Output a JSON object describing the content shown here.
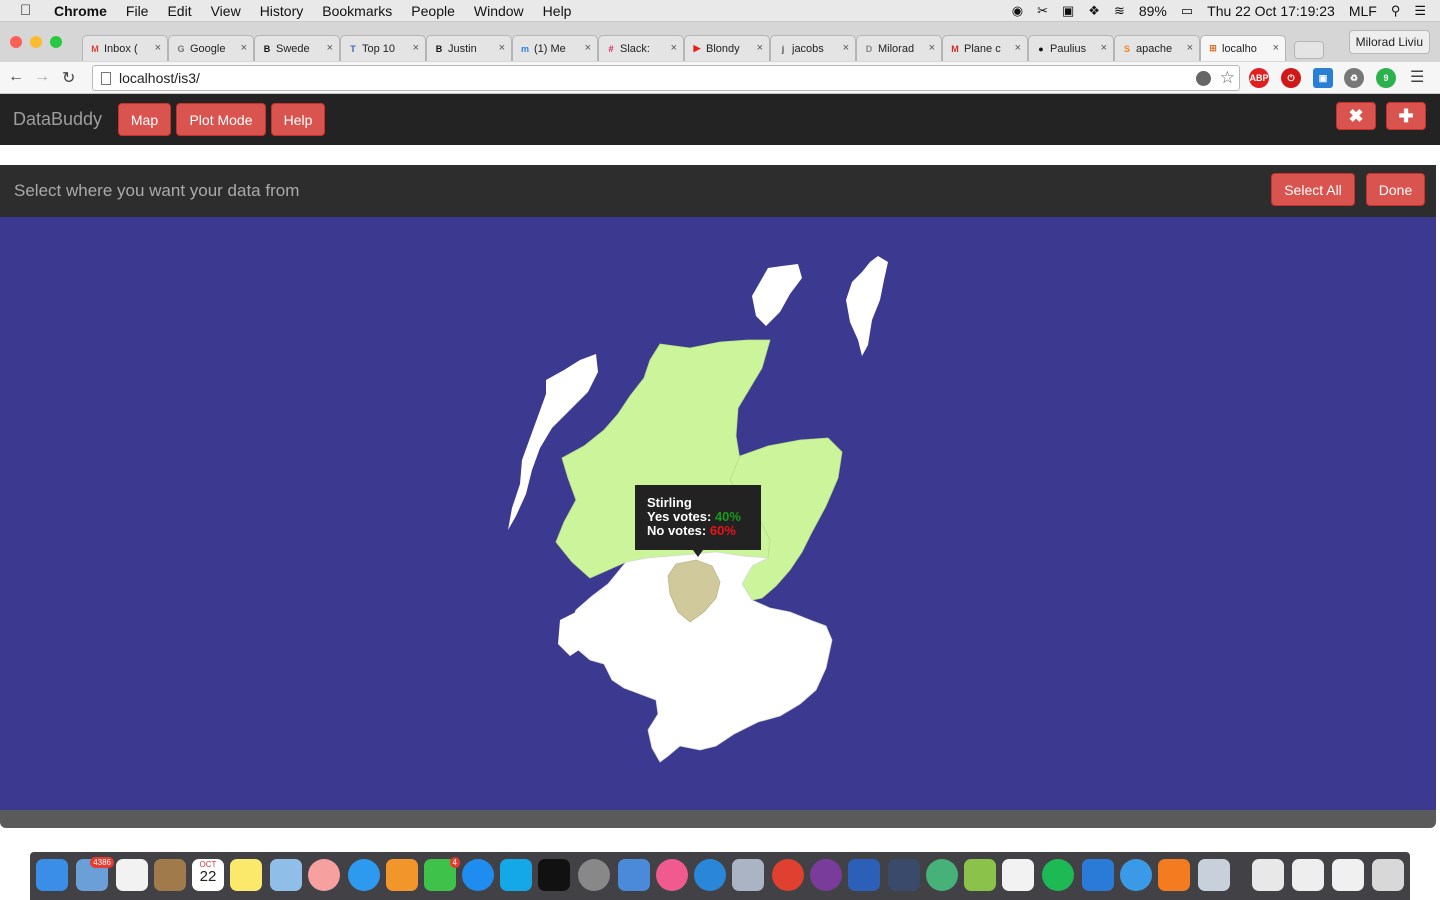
{
  "menubar": {
    "app_name": "Chrome",
    "items": [
      "File",
      "Edit",
      "View",
      "History",
      "Bookmarks",
      "People",
      "Window",
      "Help"
    ],
    "battery": "89%",
    "datetime": "Thu 22 Oct  17:19:23",
    "input_source": "MLF"
  },
  "browser": {
    "tabs": [
      {
        "title": "Inbox (",
        "icon": "gmail-icon",
        "color": "#d44638",
        "glyph": "M"
      },
      {
        "title": "Google",
        "icon": "google-docs-icon",
        "color": "#777777",
        "glyph": "G"
      },
      {
        "title": "Swede",
        "icon": "bbc-icon",
        "color": "#111111",
        "glyph": "B"
      },
      {
        "title": "Top 10",
        "icon": "page-icon",
        "color": "#3a67b8",
        "glyph": "T"
      },
      {
        "title": "Justin",
        "icon": "bbc-icon",
        "color": "#111111",
        "glyph": "B"
      },
      {
        "title": "(1) Me",
        "icon": "messenger-icon",
        "color": "#2f7cf6",
        "glyph": "m"
      },
      {
        "title": "Slack:",
        "icon": "slack-icon",
        "color": "#e01e5a",
        "glyph": "#"
      },
      {
        "title": "Blondy",
        "icon": "youtube-icon",
        "color": "#e62117",
        "glyph": "▶"
      },
      {
        "title": "jacobs",
        "icon": "page-icon",
        "color": "#555555",
        "glyph": "j"
      },
      {
        "title": "Milorad",
        "icon": "document-icon",
        "color": "#888888",
        "glyph": "D"
      },
      {
        "title": "Plane c",
        "icon": "mail-icon",
        "color": "#c9302c",
        "glyph": "M"
      },
      {
        "title": "Paulius",
        "icon": "github-icon",
        "color": "#111111",
        "glyph": "●"
      },
      {
        "title": "apache",
        "icon": "stackoverflow-icon",
        "color": "#f48024",
        "glyph": "S"
      },
      {
        "title": "localho",
        "icon": "app-icon",
        "color": "#e07020",
        "glyph": "⊞"
      }
    ],
    "profile_name": "Milorad Liviu",
    "url": "localhost/is3/"
  },
  "app": {
    "brand": "DataBuddy",
    "nav_buttons": [
      "Map",
      "Plot Mode",
      "Help"
    ],
    "close_glyph": "✖",
    "add_glyph": "✚",
    "panel_title": "Select where you want your data from",
    "select_all_label": "Select All",
    "done_label": "Done"
  },
  "tooltip": {
    "region": "Stirling",
    "yes_label": "Yes votes:",
    "yes_value": "40%",
    "no_label": "No votes:",
    "no_value": "60%"
  },
  "colors": {
    "map_background": "#3b3990",
    "selected_region": "#ccf49a",
    "hovered_region": "#d0c99b",
    "unselected_region": "#ffffff",
    "accent_button": "#d9534f"
  },
  "dock": {
    "mail_badge": "4386",
    "messages_badge": "4",
    "calendar_month": "OCT",
    "calendar_day": "22"
  }
}
